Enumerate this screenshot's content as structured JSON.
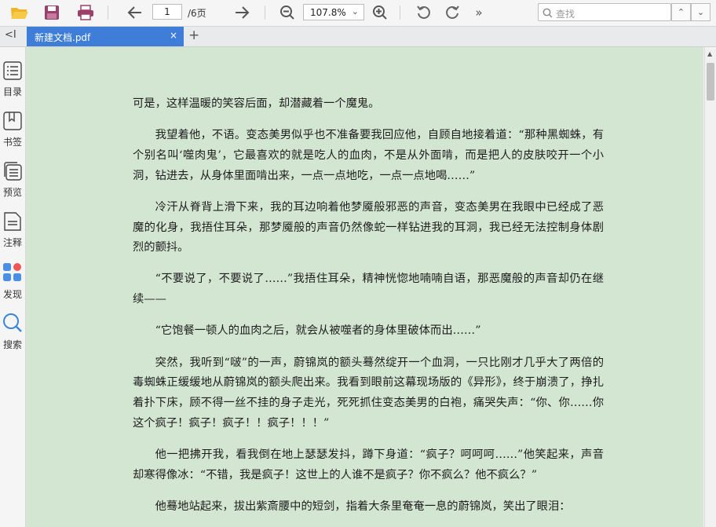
{
  "toolbar": {
    "open_icon": "folder-open-icon",
    "save_icon": "save-icon",
    "print_icon": "print-icon",
    "page_current": "1",
    "page_total": "/6页",
    "zoom": "107.8%",
    "search_placeholder": "查找",
    "more": "»"
  },
  "tab": {
    "title": "新建文档.pdf",
    "close": "×",
    "new": "+",
    "collapse": "<I"
  },
  "sidebar": {
    "items": [
      {
        "label": "目录"
      },
      {
        "label": "书签"
      },
      {
        "label": "预览"
      },
      {
        "label": "注释"
      },
      {
        "label": "发现"
      },
      {
        "label": "搜索"
      }
    ]
  },
  "document": {
    "paragraphs": [
      "可是，这样温暖的笑容后面，却潜藏着一个魔鬼。",
      "我望着他，不语。变态美男似乎也不准备要我回应他，自顾自地接着道：“那种黑蜘蛛，有个别名叫‘噬肉鬼’，它最喜欢的就是吃人的血肉，不是从外面啃，而是把人的皮肤咬开一个小洞，钻进去，从身体里面啃出来，一点一点地吃，一点一点地喝……”",
      "冷汗从脊背上滑下来，我的耳边响着他梦魇般邪恶的声音，变态美男在我眼中已经成了恶魔的化身，我捂住耳朵，那梦魇般的声音仍然像蛇一样钻进我的耳洞，我已经无法控制身体剧烈的颤抖。",
      "“不要说了，不要说了……”我捂住耳朵，精神恍惚地喃喃自语，那恶魔般的声音却仍在继续——",
      "“它饱餐一顿人的血肉之后，就会从被噬者的身体里破体而出……”",
      "突然，我听到“啵”的一声，蔚锦岚的额头蓦然绽开一个血洞，一只比刚才几乎大了两倍的毒蜘蛛正缓缓地从蔚锦岚的额头爬出来。我看到眼前这幕现场版的《异形》，终于崩溃了，挣扎着扑下床，顾不得一丝不挂的身子走光，死死抓住变态美男的白袍，痛哭失声：“你、你……你这个疯子！疯子！疯子！！疯子！！！”",
      "他一把拂开我，看我倒在地上瑟瑟发抖，蹲下身道：“疯子？呵呵呵……”他笑起来，声音却寒得像冰：“不错，我是疯子！这世上的人谁不是疯子？你不疯么？他不疯么？”",
      "他蓦地站起来，拔出紫斎腰中的短剑，指着大条里奄奄一息的蔚锦岚，笑出了眼泪："
    ]
  },
  "colors": {
    "page_bg": "#d3e6d1",
    "tab_active": "#3f7ed8"
  }
}
